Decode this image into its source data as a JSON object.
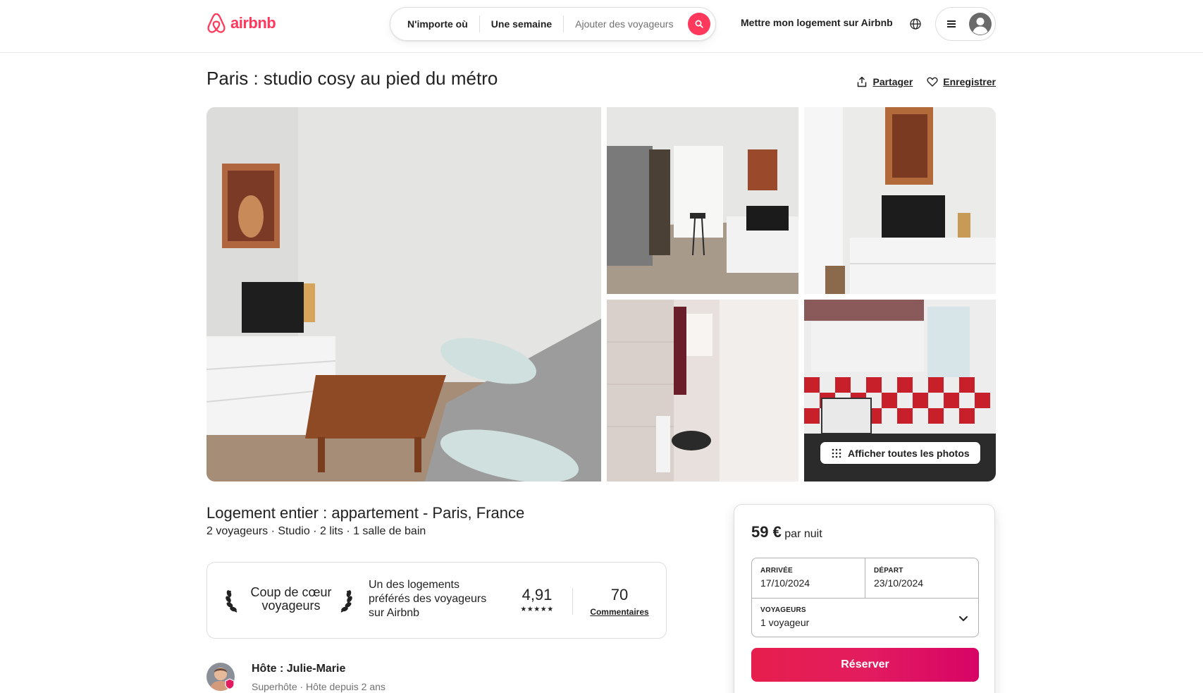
{
  "header": {
    "logo_text": "airbnb",
    "search": {
      "where": "N'importe où",
      "when": "Une semaine",
      "guests_placeholder": "Ajouter des voyageurs"
    },
    "host_link": "Mettre mon logement sur Airbnb",
    "icons": [
      "airbnb-logo-icon",
      "search-icon",
      "globe-icon",
      "menu-icon",
      "user-icon"
    ]
  },
  "listing": {
    "title": "Paris : studio cosy au pied du métro",
    "share_label": "Partager",
    "save_label": "Enregistrer",
    "show_all_photos": "Afficher toutes les photos",
    "subtitle": "Logement entier : appartement - Paris, France",
    "details": "2 voyageurs · Studio · 2 lits · 1 salle de bain"
  },
  "guest_favorite": {
    "label": "Coup de cœur voyageurs",
    "description": "Un des logements préférés des voyageurs sur Airbnb",
    "rating": "4,91",
    "stars": "★★★★★",
    "reviews_count": "70",
    "reviews_label": "Commentaires"
  },
  "host": {
    "name": "Hôte : Julie-Marie",
    "meta": "Superhôte · Hôte depuis 2 ans"
  },
  "booking": {
    "price": "59 €",
    "price_unit": "par nuit",
    "checkin_label": "Arrivée",
    "checkin_value": "17/10/2024",
    "checkout_label": "Départ",
    "checkout_value": "23/10/2024",
    "guests_label": "Voyageurs",
    "guests_value": "1 voyageur",
    "reserve_label": "Réserver"
  },
  "colors": {
    "brand": "#ff385c",
    "text": "#222222",
    "muted": "#717171",
    "border": "#dddddd"
  }
}
